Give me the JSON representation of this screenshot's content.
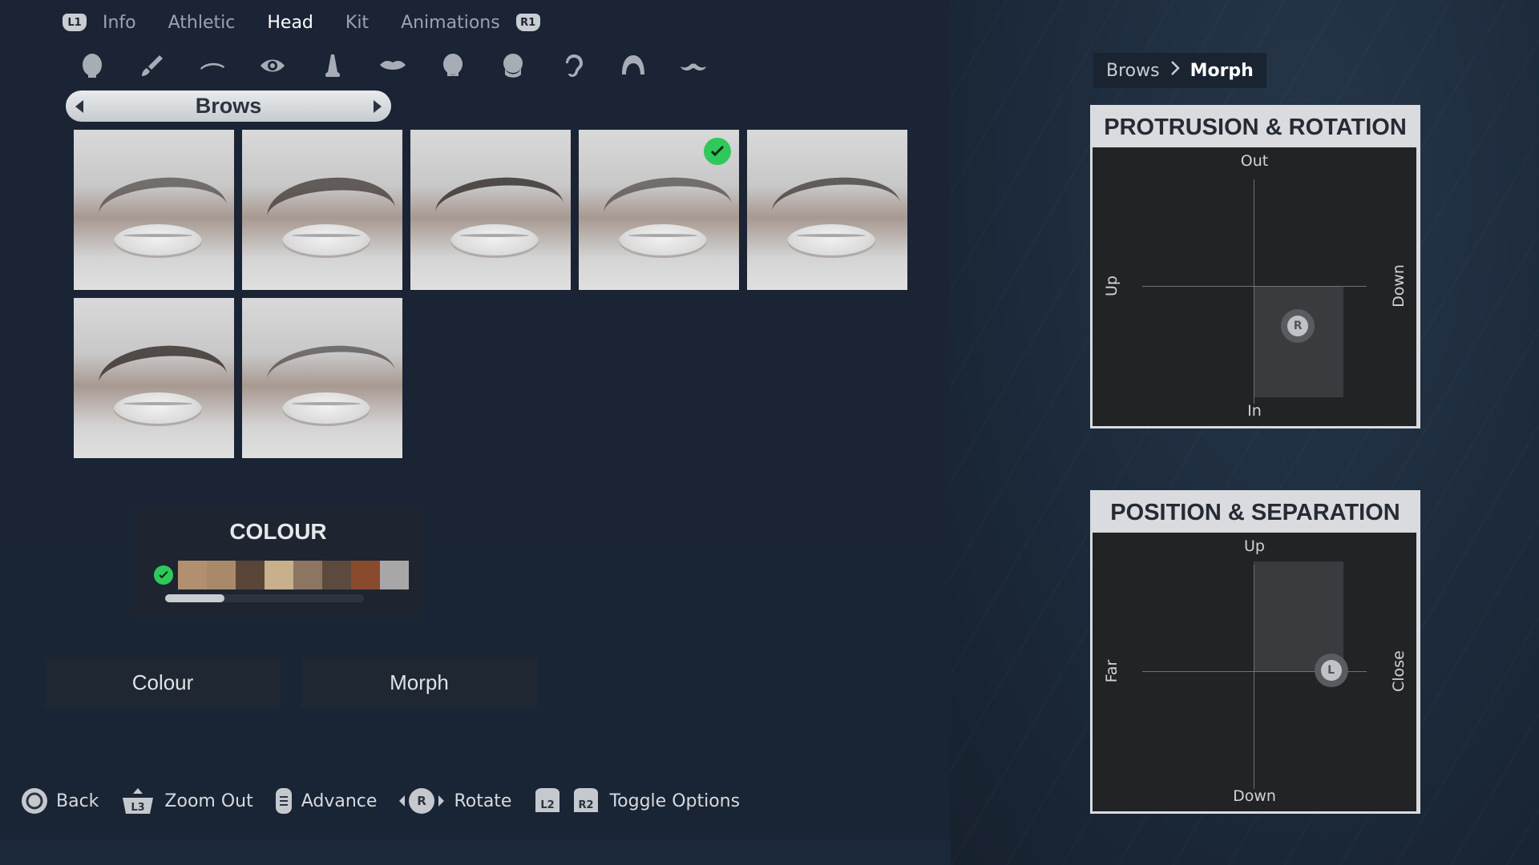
{
  "top_tabs": {
    "left_shoulder": "L1",
    "right_shoulder": "R1",
    "items": [
      {
        "label": "Info",
        "active": false
      },
      {
        "label": "Athletic",
        "active": false
      },
      {
        "label": "Head",
        "active": true
      },
      {
        "label": "Kit",
        "active": false
      },
      {
        "label": "Animations",
        "active": false
      }
    ]
  },
  "category_icons": [
    "head-icon",
    "paintbrush-icon",
    "brow-icon",
    "eye-icon",
    "nose-icon",
    "lips-icon",
    "face-icon",
    "jaw-icon",
    "ear-icon",
    "hair-icon",
    "moustache-icon"
  ],
  "selector": {
    "label": "Brows"
  },
  "brows": {
    "count": 7,
    "selected_index": 3
  },
  "colour": {
    "title": "COLOUR",
    "swatches": [
      "#b09070",
      "#a8896a",
      "#5a4539",
      "#c8b08c",
      "#8c7561",
      "#5d4a3f",
      "#8a4a2e",
      "#a8a6a6"
    ],
    "selected_index": 0,
    "scroll_fraction": 0.3
  },
  "options": {
    "colour_label": "Colour",
    "morph_label": "Morph"
  },
  "prompts": [
    {
      "button": "circle",
      "label": "Back"
    },
    {
      "button": "L3",
      "label": "Zoom Out"
    },
    {
      "button": "touchpad",
      "label": "Advance"
    },
    {
      "button": "R",
      "label": "Rotate"
    },
    {
      "button": "L2 R2",
      "label": "Toggle Options"
    }
  ],
  "prompt_buttons": {
    "l3": "L3",
    "r": "R",
    "l2": "L2",
    "r2": "R2"
  },
  "breadcrumb": {
    "parent": "Brows",
    "current": "Morph"
  },
  "pad1": {
    "title": "PROTRUSION & ROTATION",
    "top": "Out",
    "bottom": "In",
    "left": "Up",
    "right": "Down",
    "stick": "R",
    "value_x": 0.4,
    "value_y": -0.36
  },
  "pad2": {
    "title": "POSITION & SEPARATION",
    "top": "Up",
    "bottom": "Down",
    "left": "Far",
    "right": "Close",
    "stick": "L",
    "value_x": 0.7,
    "value_y": 0.01
  }
}
